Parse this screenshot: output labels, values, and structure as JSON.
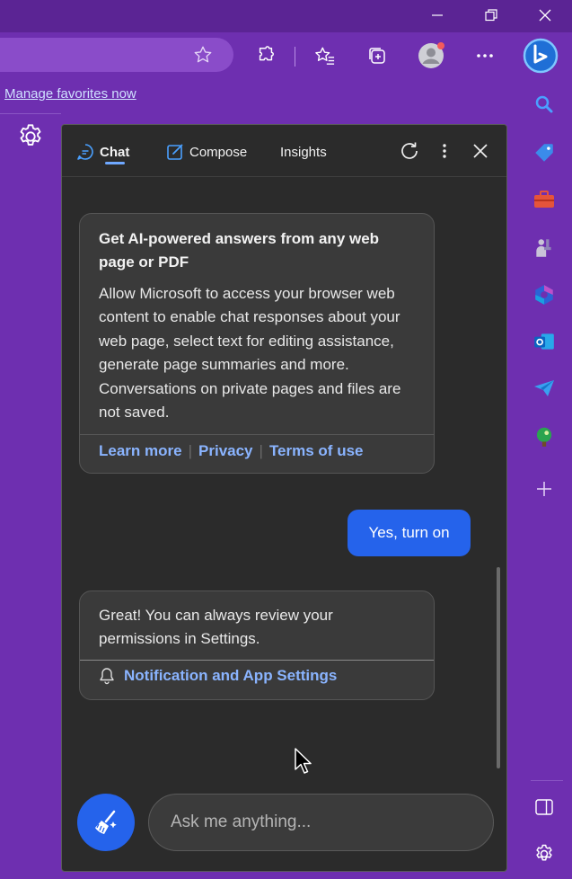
{
  "favorites_bar": {
    "manage_link": "Manage favorites now"
  },
  "copilot": {
    "tabs": [
      {
        "label": "Chat"
      },
      {
        "label": "Compose"
      },
      {
        "label": "Insights"
      }
    ],
    "intro_card": {
      "title": "Get AI-powered answers from any web page or PDF",
      "body": "Allow Microsoft to access your browser web content to enable chat responses about your web page, select text for editing assistance, generate page summaries and more. Conversations on private pages and files are not saved.",
      "links": [
        "Learn more",
        "Privacy",
        "Terms of use"
      ]
    },
    "user_message": "Yes, turn on",
    "reply_card": {
      "body": "Great! You can always review your permissions in Settings.",
      "settings_link": "Notification and App Settings"
    },
    "input_placeholder": "Ask me anything..."
  },
  "colors": {
    "frame_purple": "#6e2fb0",
    "panel_bg": "#2b2b2b",
    "card_bg": "#3a3a3a",
    "accent_blue": "#2563eb",
    "link_blue": "#8ab4ff"
  },
  "icons": {
    "window": [
      "minimize-icon",
      "restore-icon",
      "close-icon"
    ],
    "toolbar": [
      "star-icon",
      "extensions-icon",
      "favorites-icon",
      "collections-icon",
      "profile-avatar",
      "more-icon",
      "copilot-icon"
    ],
    "rail": [
      "search-icon",
      "shopping-icon",
      "tools-icon",
      "games-icon",
      "microsoft365-icon",
      "outlook-icon",
      "drop-icon",
      "app-icon",
      "add-icon",
      "sidebar-toggle-icon",
      "settings-icon"
    ]
  }
}
